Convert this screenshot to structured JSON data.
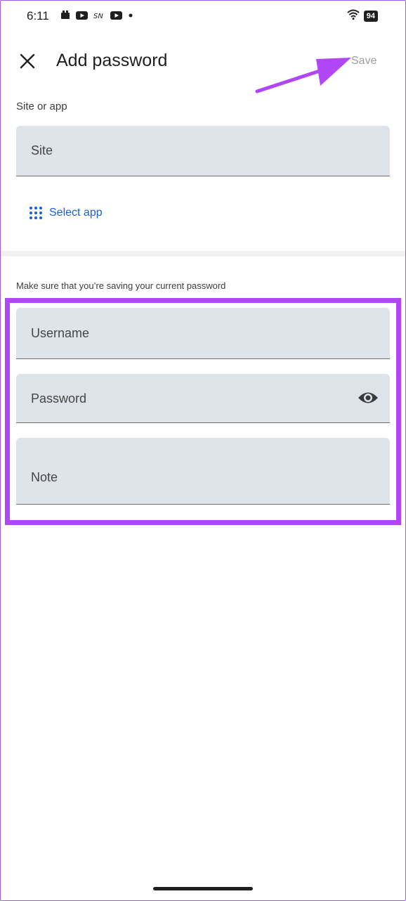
{
  "status_bar": {
    "time": "6:11",
    "battery": "94",
    "icons_left": [
      "photo-icon",
      "youtube-icon",
      "sn-icon",
      "youtube-icon",
      "dot-icon"
    ],
    "icons_right": [
      "wifi-icon",
      "battery-icon"
    ]
  },
  "header": {
    "title": "Add password",
    "save_label": "Save",
    "close_icon": "close-icon"
  },
  "site_section": {
    "label": "Site or app",
    "site_placeholder": "Site",
    "select_app_label": "Select app",
    "select_app_icon": "apps-grid-icon"
  },
  "credentials_section": {
    "hint": "Make sure that you’re saving your current password",
    "username_placeholder": "Username",
    "password_placeholder": "Password",
    "note_placeholder": "Note",
    "visibility_icon": "eye-icon"
  },
  "colors": {
    "highlight": "#b046f5",
    "link": "#1a5fd1",
    "field_bg": "#dfe3ea",
    "save_disabled": "#9e9e9e"
  }
}
